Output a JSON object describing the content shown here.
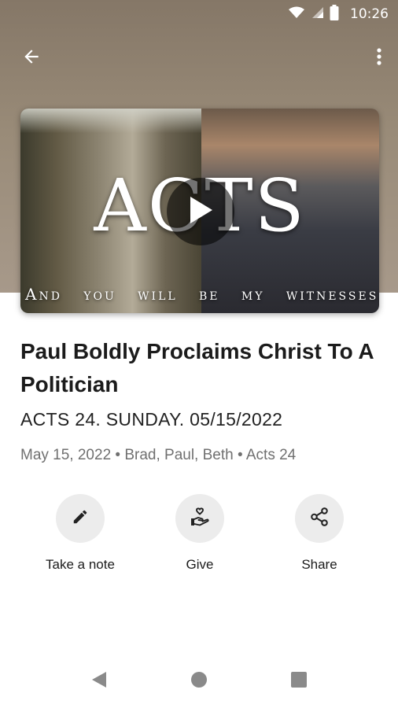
{
  "status_bar": {
    "time": "10:26",
    "icons": [
      "wifi-icon",
      "signal-icon",
      "battery-icon"
    ]
  },
  "app_bar": {
    "back_icon": "arrow-back-icon",
    "more_icon": "more-vertical-icon"
  },
  "video": {
    "title": "ACTS",
    "subtitle": "And you will be my witnesses...",
    "play_icon": "play-icon"
  },
  "sermon": {
    "title": "Paul Boldly Proclaims Christ To A Politician",
    "subtitle": "ACTS 24. SUNDAY. 05/15/2022",
    "meta": "May 15, 2022 • Brad, Paul, Beth • Acts 24"
  },
  "actions": [
    {
      "label": "Take a note",
      "icon": "pencil-icon"
    },
    {
      "label": "Give",
      "icon": "heart-hand-icon"
    },
    {
      "label": "Share",
      "icon": "share-icon"
    }
  ],
  "nav_bar": {
    "back": "nav-back-icon",
    "home": "nav-home-icon",
    "recents": "nav-recents-icon"
  },
  "colors": {
    "hero_bg": "#998b78",
    "action_circle": "#ececec",
    "meta_text": "#707070"
  }
}
